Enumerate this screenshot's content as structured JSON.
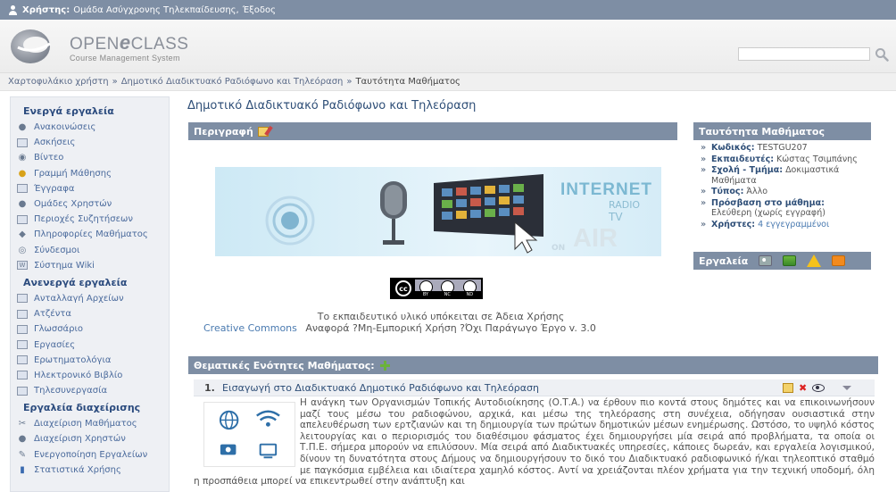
{
  "userbar": {
    "label": "Χρήστης:",
    "name": "Ομάδα Ασύγχρονης Τηλεκπαίδευσης",
    "separator": ",",
    "logout": "Έξοδος"
  },
  "logo": {
    "title_open": "OPEN",
    "title_e": "e",
    "title_class": "CLASS",
    "subtitle": "Course Management System"
  },
  "search": {
    "placeholder": ""
  },
  "breadcrumb": {
    "items": [
      "Χαρτοφυλάκιο χρήστη",
      "»",
      "Δημοτικό Διαδικτυακό Ραδιόφωνο και Τηλεόραση",
      "»",
      "Ταυτότητα Μαθήματος"
    ]
  },
  "sidebar": {
    "active_title": "Ενεργά εργαλεία",
    "active": [
      {
        "label": "Ανακοινώσεις",
        "icon": "megaphone-icon"
      },
      {
        "label": "Ασκήσεις",
        "icon": "exercise-icon"
      },
      {
        "label": "Βίντεο",
        "icon": "video-icon"
      },
      {
        "label": "Γραμμή Μάθησης",
        "icon": "learning-path-icon"
      },
      {
        "label": "Έγγραφα",
        "icon": "folder-icon"
      },
      {
        "label": "Ομάδες Χρηστών",
        "icon": "groups-icon"
      },
      {
        "label": "Περιοχές Συζητήσεων",
        "icon": "forum-icon"
      },
      {
        "label": "Πληροφορίες Μαθήματος",
        "icon": "info-icon"
      },
      {
        "label": "Σύνδεσμοι",
        "icon": "link-icon"
      },
      {
        "label": "Σύστημα Wiki",
        "icon": "wiki-icon"
      }
    ],
    "inactive_title": "Ανενεργά εργαλεία",
    "inactive": [
      {
        "label": "Ανταλλαγή Αρχείων",
        "icon": "file-exchange-icon"
      },
      {
        "label": "Ατζέντα",
        "icon": "calendar-icon"
      },
      {
        "label": "Γλωσσάριο",
        "icon": "glossary-icon"
      },
      {
        "label": "Εργασίες",
        "icon": "assignments-icon"
      },
      {
        "label": "Ερωτηματολόγια",
        "icon": "questionnaire-icon"
      },
      {
        "label": "Ηλεκτρονικό Βιβλίο",
        "icon": "ebook-icon"
      },
      {
        "label": "Τηλεσυνεργασία",
        "icon": "conference-icon"
      }
    ],
    "admin_title": "Εργαλεία διαχείρισης",
    "admin": [
      {
        "label": "Διαχείριση Μαθήματος",
        "icon": "wrench-icon"
      },
      {
        "label": "Διαχείριση Χρηστών",
        "icon": "users-icon"
      },
      {
        "label": "Ενεργοποίηση Εργαλείων",
        "icon": "tools-activate-icon"
      },
      {
        "label": "Στατιστικά Χρήσης",
        "icon": "stats-icon"
      }
    ]
  },
  "main": {
    "course_title": "Δημοτικό Διαδικτυακό Ραδιόφωνο και Τηλεόραση",
    "description_label": "Περιγραφή",
    "banner": {
      "internet": "INTERNET",
      "radio": "RADIO",
      "tv": "TV",
      "on": "ON",
      "air": "AIR"
    },
    "cc_badge": {
      "cc": "cc",
      "by": "BY",
      "nc": "NC",
      "nd": "ND"
    },
    "license_line1": "Το εκπαιδευτικό υλικό υπόκειται σε Άδεια Χρήσης",
    "license_link": "Creative Commons",
    "license_line2": "Αναφορά ?Μη-Εμπορική Χρήση ?Όχι Παράγωγο Έργο v. 3.0",
    "units_title": "Θεματικές Ενότητες Μαθήματος:",
    "unit": {
      "number": "1.",
      "title": "Εισαγωγή στο Διαδικτυακό Δημοτικό Ραδιόφωνο και Τηλεόραση",
      "text": "Η ανάγκη των Οργανισμών Τοπικής Αυτοδιοίκησης (Ο.Τ.Α.) να έρθουν πιο κοντά στους δημότες και να επικοινωνήσουν μαζί τους μέσω του ραδιοφώνου, αρχικά, και μέσω της τηλεόρασης στη συνέχεια, οδήγησαν ουσιαστικά στην απελευθέρωση των ερτζιανών και τη δημιουργία των πρώτων δημοτικών μέσων ενημέρωσης. Ωστόσο, το υψηλό κόστος λειτουργίας και ο περιορισμός του διαθέσιμου φάσματος έχει δημιουργήσει μία σειρά από προβλήματα, τα οποία οι Τ.Π.Ε. σήμερα μπορούν να επιλύσουν. Μία σειρά από Διαδικτυακές υπηρεσίες, κάποιες δωρεάν, και εργαλεία λογισμικού, δίνουν τη δυνατότητα στους Δήμους να δημιουργήσουν το δικό του Διαδικτυακό ραδιοφωνικό ή/και τηλεοπτικό σταθμό με παγκόσμια εμβέλεια και ιδιαίτερα χαμηλό κόστος. Αντί να χρειάζονται πλέον χρήματα για την τεχνική υποδομή, όλη η προσπάθεια μπορεί να επικεντρωθεί στην ανάπτυξη και"
    }
  },
  "identity": {
    "title": "Ταυτότητα Μαθήματος",
    "code_label": "Κωδικός:",
    "code": "TESTGU207",
    "instructors_label": "Εκπαιδευτές:",
    "instructors": "Κώστας Τσιμπάνης",
    "school_label": "Σχολή - Τμήμα:",
    "school": "Δοκιμαστικά Μαθήματα",
    "type_label": "Τύπος:",
    "type": "Άλλο",
    "access_label": "Πρόσβαση στο μάθημα:",
    "access": "Ελεύθερη (χωρίς εγγραφή)",
    "users_label": "Χρήστες:",
    "users": "4 εγγεγραμμένοι",
    "bullet": "»"
  },
  "tools": {
    "title": "Εργαλεία"
  },
  "colors": {
    "bar": "#7e8ea4",
    "link": "#4a7ab0",
    "title": "#2f4f78"
  }
}
